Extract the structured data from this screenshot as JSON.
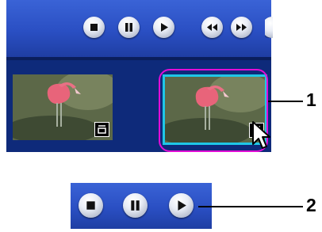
{
  "player": {
    "toolbar": {
      "buttons": [
        {
          "name": "stop",
          "icon": "stop-icon"
        },
        {
          "name": "pause",
          "icon": "pause-icon"
        },
        {
          "name": "play",
          "icon": "play-icon"
        },
        {
          "name": "rewind",
          "icon": "rewind-icon"
        },
        {
          "name": "fast-forward",
          "icon": "fast-forward-icon"
        }
      ]
    },
    "thumbnails": [
      {
        "subject": "flamingo",
        "selected": false,
        "badge_icon": "multiview-icon"
      },
      {
        "subject": "flamingo",
        "selected": true,
        "badge_icon": "multiview-icon"
      }
    ],
    "selection_color": "#1fc7e7",
    "highlight_color": "#e20dd6"
  },
  "controls_detail": {
    "buttons": [
      {
        "name": "stop",
        "icon": "stop-icon"
      },
      {
        "name": "pause",
        "icon": "pause-icon"
      },
      {
        "name": "play",
        "icon": "play-icon"
      }
    ]
  },
  "callouts": {
    "one": "1",
    "two": "2"
  }
}
